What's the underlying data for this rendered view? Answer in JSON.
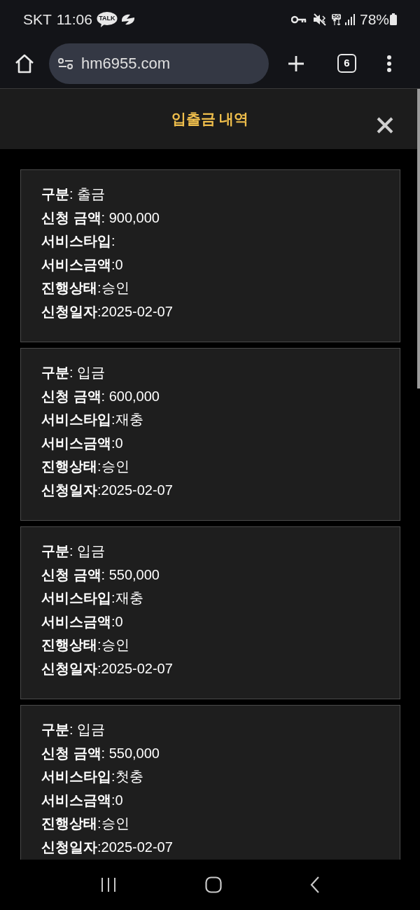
{
  "status_bar": {
    "carrier": "SKT",
    "time": "11:06",
    "talk_badge": "TALK",
    "network": "5G",
    "battery": "78%"
  },
  "browser": {
    "url": "hm6955.com",
    "tab_count": "6"
  },
  "dialog": {
    "title": "입출금 내역",
    "records": [
      {
        "lines": [
          "**구분**: 출금",
          "**신청 금액**: 900,000",
          "**서비스타입**:",
          "**서비스금액**:0",
          "**진행상태**:승인",
          "**신청일자**:2025-02-07"
        ]
      },
      {
        "lines": [
          "**구분**: 입금",
          "**신청 금액**: 600,000",
          "**서비스타입**:재충",
          "**서비스금액**:0",
          "**진행상태**:승인",
          "**신청일자**:2025-02-07"
        ]
      },
      {
        "lines": [
          "**구분**: 입금",
          "**신청 금액**: 550,000",
          "**서비스타입**:재충",
          "**서비스금액**:0",
          "**진행상태**:승인",
          "**신청일자**:2025-02-07"
        ]
      },
      {
        "lines": [
          "**구분**: 입금",
          "**신청 금액**: 550,000",
          "**서비스타입**:첫충",
          "**서비스금액**:0",
          "**진행상태**:승인",
          "**신청일자**:2025-02-07"
        ]
      }
    ]
  }
}
